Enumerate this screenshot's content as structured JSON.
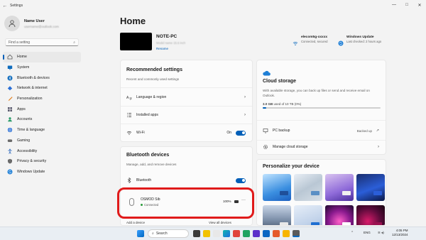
{
  "window": {
    "title": "Settings",
    "back": "←",
    "minimize": "—",
    "maximize": "□",
    "close": "✕"
  },
  "user": {
    "name": "Name User",
    "email": "username@outlook.com"
  },
  "search": {
    "placeholder": "Find a setting"
  },
  "nav": [
    {
      "label": "Home",
      "icon": "home-icon",
      "color": "#555555",
      "active": true
    },
    {
      "label": "System",
      "icon": "system-icon",
      "color": "#0f6cbd"
    },
    {
      "label": "Bluetooth & devices",
      "icon": "bluetooth-icon",
      "color": "#0f6cbd"
    },
    {
      "label": "Network & internet",
      "icon": "network-icon",
      "color": "#2a6fd6"
    },
    {
      "label": "Personalization",
      "icon": "brush-icon",
      "color": "#e07b1a"
    },
    {
      "label": "Apps",
      "icon": "apps-icon",
      "color": "#5a5a6e"
    },
    {
      "label": "Accounts",
      "icon": "accounts-icon",
      "color": "#2b9c6a"
    },
    {
      "label": "Time & language",
      "icon": "globe-icon",
      "color": "#2a6fd6"
    },
    {
      "label": "Gaming",
      "icon": "gaming-icon",
      "color": "#6b6b6b"
    },
    {
      "label": "Accessibility",
      "icon": "accessibility-icon",
      "color": "#1f5fb8"
    },
    {
      "label": "Privacy & security",
      "icon": "shield-icon",
      "color": "#6b6b6b"
    },
    {
      "label": "Windows Update",
      "icon": "update-icon",
      "color": "#1f7fd6"
    }
  ],
  "main": {
    "title": "Home"
  },
  "device": {
    "name": "NOTE-PC",
    "model": "Model name 15.6 inch",
    "rename": "Rename"
  },
  "status": {
    "wifi": {
      "name": "elecom5g-xxxxx",
      "detail": "Connected, secured"
    },
    "update": {
      "name": "Windows Update",
      "detail": "Last checked: 2 hours ago"
    }
  },
  "recommended": {
    "title": "Recommended settings",
    "subtitle": "Recent and commonly used settings",
    "items": [
      {
        "label": "Language & region",
        "icon": "language-icon"
      },
      {
        "label": "Installed apps",
        "icon": "list-icon"
      },
      {
        "label": "Wi-Fi",
        "icon": "wifi-icon",
        "toggle_label": "On"
      }
    ]
  },
  "bluetooth": {
    "title": "Bluetooth devices",
    "subtitle": "Manage, add, and remove devices",
    "toggle_label": "Bluetooth",
    "device": {
      "name": "OSMOD Sib",
      "status": "Connected",
      "battery": "100%",
      "more": "···"
    },
    "partial_left": "Add a device",
    "partial_right": "View all devices"
  },
  "cloud": {
    "title": "Cloud storage",
    "description": "With available storage, you can back up files or send and receive email on Outlook.",
    "usage_bold": "3.0 GB",
    "usage_rest": "used of 10 TB (0%)",
    "usage_fraction": 0.03,
    "backup_label": "PC backup",
    "backup_status": "Backed up",
    "manage_label": "Manage cloud storage"
  },
  "personalize": {
    "title": "Personalize your device"
  },
  "taskbar": {
    "search_label": "Search",
    "lang": "ENG",
    "time": "4:05 PM",
    "date": "12/13/2024"
  }
}
